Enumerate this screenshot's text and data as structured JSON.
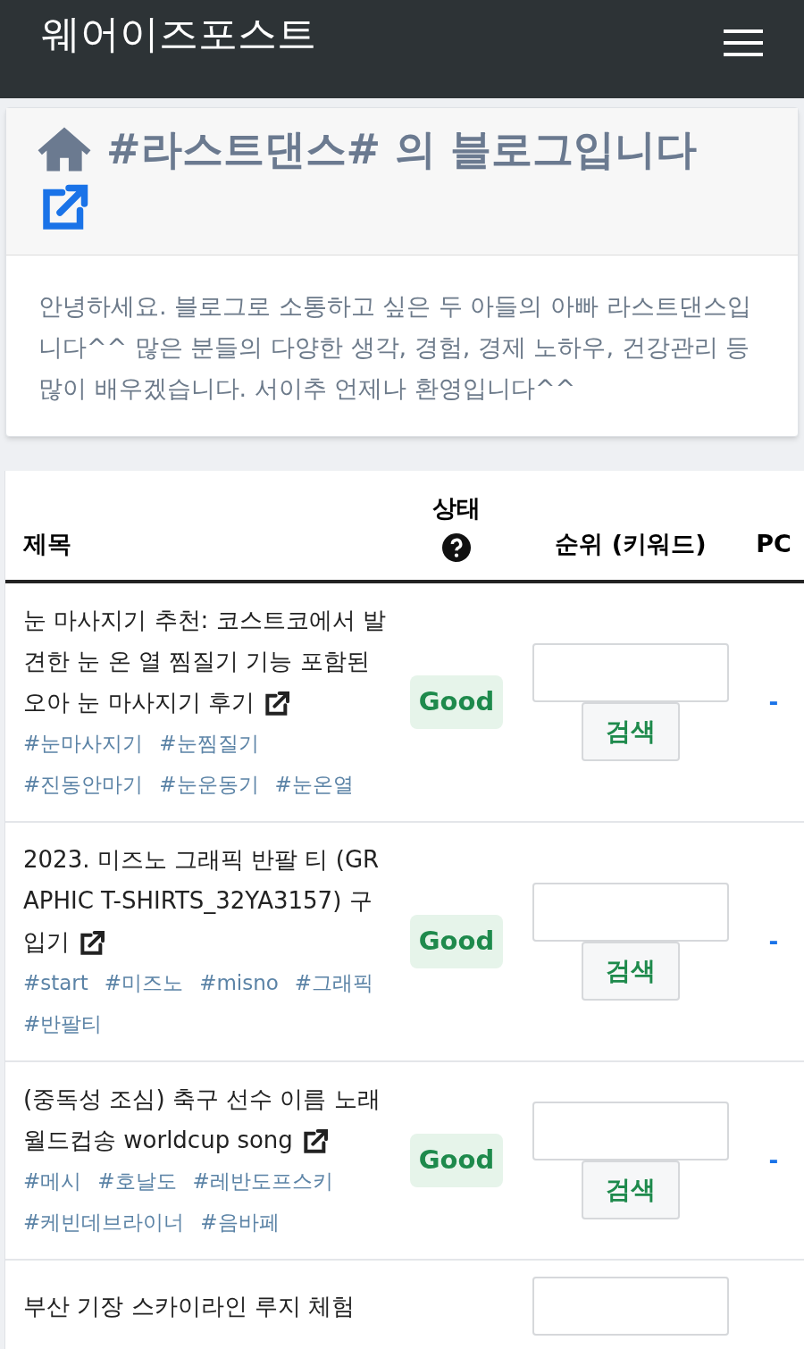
{
  "navbar": {
    "brand": "웨어이즈포스트"
  },
  "blog": {
    "title": "#라스트댄스# 의 블로그입니다",
    "description": "안녕하세요. 블로그로 소통하고 싶은 두 아들의 아빠 라스트댄스입니다^^ 많은 분들의 다양한 생각, 경험, 경제 노하우, 건강관리 등 많이 배우겠습니다. 서이추 언제나 환영입니다^^"
  },
  "table": {
    "columns": [
      {
        "label": "제목"
      },
      {
        "label": "상태"
      },
      {
        "label": "순위 (키워드)"
      },
      {
        "label": "PC"
      }
    ],
    "rows": [
      {
        "title": "눈 마사지기 추천: 코스트코에서 발견한 눈 온 열 찜질기 기능 포함된 오아 눈 마사지기 후기",
        "tags": [
          "#눈마사지기",
          "#눈찜질기",
          "#진동안마기",
          "#눈운동기",
          "#눈온열"
        ],
        "status": "Good",
        "button": "검색",
        "pc": "-"
      },
      {
        "title": "2023. 미즈노 그래픽 반팔 티 (GRAPHIC T-SHIRTS_32YA3157) 구입기",
        "tags": [
          "#start",
          "#미즈노",
          "#misno",
          "#그래픽",
          "#반팔티"
        ],
        "status": "Good",
        "button": "검색",
        "pc": "-"
      },
      {
        "title": "(중독성 조심) 축구 선수 이름 노래 월드컵송 worldcup song",
        "tags": [
          "#메시",
          "#호날도",
          "#레반도프스키",
          "#케빈데브라이너",
          "#음바페"
        ],
        "status": "Good",
        "button": "검색",
        "pc": "-"
      },
      {
        "title": "부산 기장 스카이라인 루지 체험"
      }
    ]
  }
}
